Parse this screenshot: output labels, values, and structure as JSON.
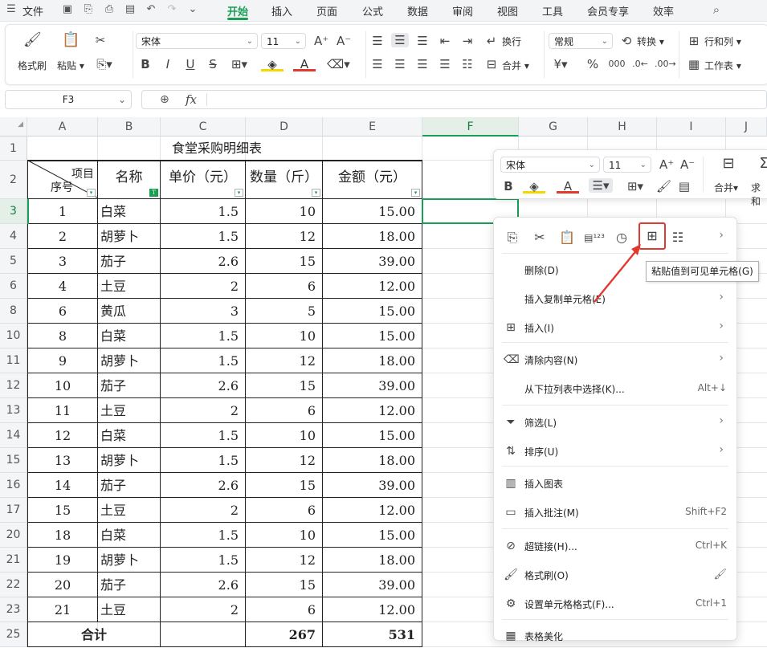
{
  "menubar": {
    "file": "文件",
    "tabs": [
      "开始",
      "插入",
      "页面",
      "公式",
      "数据",
      "审阅",
      "视图",
      "工具",
      "会员专享",
      "效率"
    ],
    "active_tab": "开始"
  },
  "ribbon": {
    "format_painter": "格式刷",
    "paste": "粘贴",
    "font_name": "宋体",
    "font_size": "11",
    "wrap": "换行",
    "merge": "合并",
    "number_format": "常规",
    "convert": "转换",
    "rows_cols": "行和列",
    "worksheet": "工作表"
  },
  "formula_bar": {
    "name_box": "F3",
    "fx": "fx",
    "value": ""
  },
  "sheet": {
    "columns": [
      "A",
      "B",
      "C",
      "D",
      "E",
      "F",
      "G",
      "H",
      "I",
      "J"
    ],
    "selected_column": "F",
    "title": "食堂采购明细表",
    "header_diag_top": "项目",
    "header_diag_bottom": "序号",
    "headers": [
      "名称",
      "单价（元）",
      "数量（斤）",
      "金额（元）"
    ],
    "rows": [
      {
        "r": "3",
        "seq": "1",
        "name": "白菜",
        "price": "1.5",
        "qty": "10",
        "amt": "15.00"
      },
      {
        "r": "4",
        "seq": "2",
        "name": "胡萝卜",
        "price": "1.5",
        "qty": "12",
        "amt": "18.00"
      },
      {
        "r": "5",
        "seq": "3",
        "name": "茄子",
        "price": "2.6",
        "qty": "15",
        "amt": "39.00"
      },
      {
        "r": "6",
        "seq": "4",
        "name": "土豆",
        "price": "2",
        "qty": "6",
        "amt": "12.00"
      },
      {
        "r": "8",
        "seq": "6",
        "name": "黄瓜",
        "price": "3",
        "qty": "5",
        "amt": "15.00"
      },
      {
        "r": "10",
        "seq": "8",
        "name": "白菜",
        "price": "1.5",
        "qty": "10",
        "amt": "15.00"
      },
      {
        "r": "11",
        "seq": "9",
        "name": "胡萝卜",
        "price": "1.5",
        "qty": "12",
        "amt": "18.00"
      },
      {
        "r": "12",
        "seq": "10",
        "name": "茄子",
        "price": "2.6",
        "qty": "15",
        "amt": "39.00"
      },
      {
        "r": "13",
        "seq": "11",
        "name": "土豆",
        "price": "2",
        "qty": "6",
        "amt": "12.00"
      },
      {
        "r": "14",
        "seq": "12",
        "name": "白菜",
        "price": "1.5",
        "qty": "10",
        "amt": "15.00"
      },
      {
        "r": "15",
        "seq": "13",
        "name": "胡萝卜",
        "price": "1.5",
        "qty": "12",
        "amt": "18.00"
      },
      {
        "r": "16",
        "seq": "14",
        "name": "茄子",
        "price": "2.6",
        "qty": "15",
        "amt": "39.00"
      },
      {
        "r": "17",
        "seq": "15",
        "name": "土豆",
        "price": "2",
        "qty": "6",
        "amt": "12.00"
      },
      {
        "r": "20",
        "seq": "18",
        "name": "白菜",
        "price": "1.5",
        "qty": "10",
        "amt": "15.00"
      },
      {
        "r": "21",
        "seq": "19",
        "name": "胡萝卜",
        "price": "1.5",
        "qty": "12",
        "amt": "18.00"
      },
      {
        "r": "22",
        "seq": "20",
        "name": "茄子",
        "price": "2.6",
        "qty": "15",
        "amt": "39.00"
      },
      {
        "r": "23",
        "seq": "21",
        "name": "土豆",
        "price": "2",
        "qty": "6",
        "amt": "12.00"
      }
    ],
    "total_row": {
      "r": "25",
      "label": "合计",
      "qty": "267",
      "amt": "531"
    }
  },
  "minibar": {
    "font_name": "宋体",
    "font_size": "11",
    "merge": "合并",
    "sum": "求和"
  },
  "context_menu": {
    "tooltip": "粘贴值到可见单元格(G)",
    "items": [
      {
        "label": "删除(D)",
        "short": "",
        "arrow": false,
        "icon": ""
      },
      {
        "label": "插入复制单元格(E)",
        "short": "",
        "arrow": true,
        "icon": ""
      },
      {
        "label": "插入(I)",
        "short": "",
        "arrow": true,
        "icon": "insert-icon"
      },
      {
        "label": "清除内容(N)",
        "short": "",
        "arrow": true,
        "icon": "eraser-icon"
      },
      {
        "label": "从下拉列表中选择(K)...",
        "short": "Alt+↓",
        "arrow": false,
        "icon": ""
      },
      {
        "label": "筛选(L)",
        "short": "",
        "arrow": true,
        "icon": "filter-icon"
      },
      {
        "label": "排序(U)",
        "short": "",
        "arrow": true,
        "icon": "sort-icon"
      },
      {
        "label": "插入图表",
        "short": "",
        "arrow": false,
        "icon": "chart-icon"
      },
      {
        "label": "插入批注(M)",
        "short": "Shift+F2",
        "arrow": false,
        "icon": "comment-icon"
      },
      {
        "label": "超链接(H)...",
        "short": "Ctrl+K",
        "arrow": false,
        "icon": "link-icon"
      },
      {
        "label": "格式刷(O)",
        "short": "",
        "arrow": false,
        "icon": "format-painter-icon"
      },
      {
        "label": "设置单元格格式(F)...",
        "short": "Ctrl+1",
        "arrow": false,
        "icon": "cell-format-icon"
      },
      {
        "label": "表格美化",
        "short": "",
        "arrow": false,
        "icon": "beautify-icon"
      }
    ]
  },
  "colors": {
    "accent": "#1a9e55",
    "highlight_red": "#e03a2f"
  }
}
